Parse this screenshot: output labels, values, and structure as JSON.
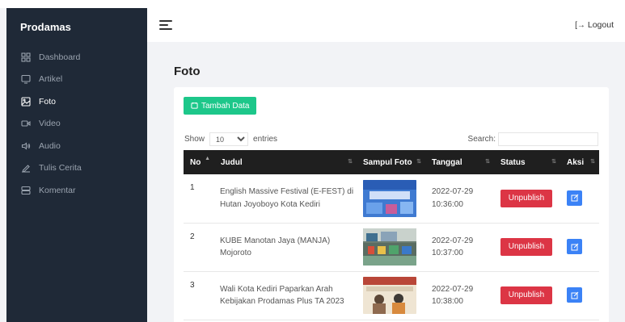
{
  "brand": "Prodamas",
  "sidebar": {
    "items": [
      {
        "label": "Dashboard",
        "icon": "grid-icon",
        "active": false
      },
      {
        "label": "Artikel",
        "icon": "monitor-icon",
        "active": false
      },
      {
        "label": "Foto",
        "icon": "image-icon",
        "active": true
      },
      {
        "label": "Video",
        "icon": "video-icon",
        "active": false
      },
      {
        "label": "Audio",
        "icon": "speaker-icon",
        "active": false
      },
      {
        "label": "Tulis Cerita",
        "icon": "pen-icon",
        "active": false
      },
      {
        "label": "Komentar",
        "icon": "server-icon",
        "active": false
      }
    ]
  },
  "topbar": {
    "logout_label": "Logout",
    "logout_icon": "[→"
  },
  "page": {
    "title": "Foto"
  },
  "toolbar": {
    "add_label": "Tambah Data"
  },
  "entries": {
    "show_label": "Show",
    "value": "10",
    "suffix": "entries"
  },
  "search": {
    "label": "Search:",
    "placeholder": ""
  },
  "table": {
    "headers": {
      "no": "No",
      "judul": "Judul",
      "sampul": "Sampul Foto",
      "tanggal": "Tanggal",
      "status": "Status",
      "aksi": "Aksi"
    },
    "rows": [
      {
        "no": "1",
        "judul_1": "English Massive Festival (E-FEST) di",
        "judul_2": "Hutan Joyoboyo Kota Kediri",
        "date": "2022-07-29",
        "time": "10:36:00",
        "status_label": "Unpublish",
        "thumb": "blue"
      },
      {
        "no": "2",
        "judul_1": "KUBE Manotan Jaya (MANJA)",
        "judul_2": "Mojoroto",
        "date": "2022-07-29",
        "time": "10:37:00",
        "status_label": "Unpublish",
        "thumb": "shop"
      },
      {
        "no": "3",
        "judul_1": "Wali Kota Kediri Paparkan Arah",
        "judul_2": "Kebijakan Prodamas Plus TA 2023",
        "date": "2022-07-29",
        "time": "10:38:00",
        "status_label": "Unpublish",
        "thumb": "meeting"
      }
    ]
  },
  "colors": {
    "sidebar": "#1f2937",
    "add": "#1dc78a",
    "unpublish": "#dc3545",
    "edit": "#3b82f6",
    "table_head": "#1f1f1f"
  }
}
